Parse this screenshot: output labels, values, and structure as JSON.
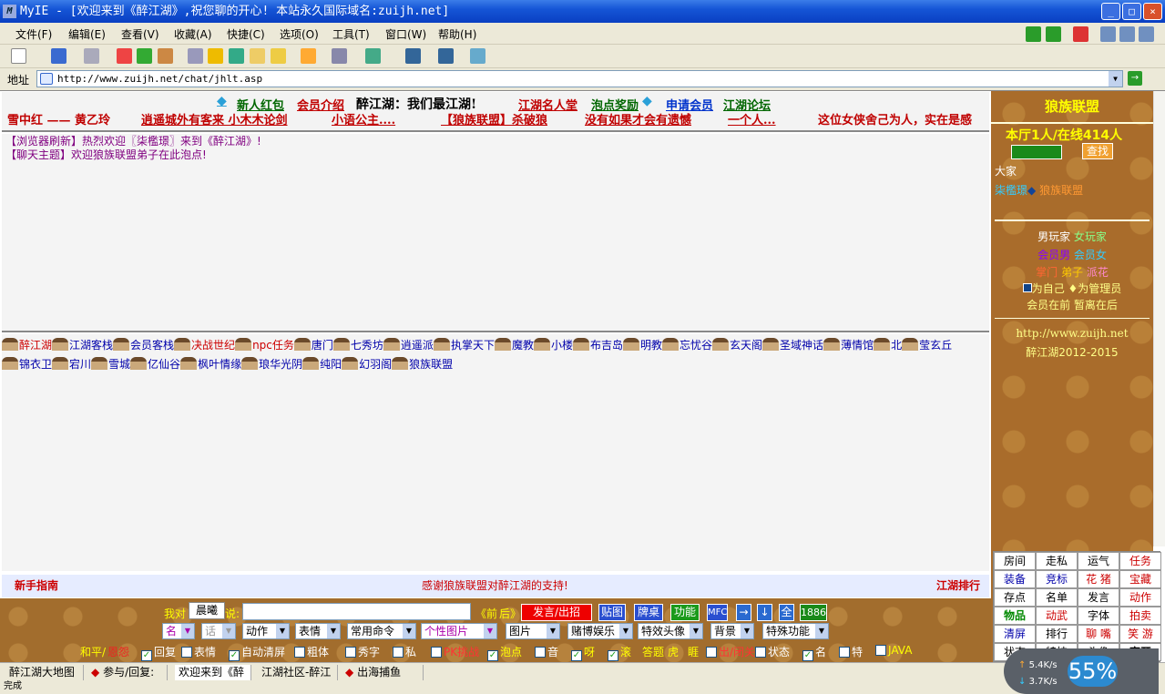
{
  "window": {
    "title": "MyIE - [欢迎来到《醉江湖》,祝您聊的开心! 本站永久国际域名:zuijh.net]",
    "logo": "M",
    "btn_minimize": "_",
    "btn_maximize": "□",
    "btn_close": "×"
  },
  "menu": [
    "文件(F)",
    "编辑(E)",
    "查看(V)",
    "收藏(A)",
    "快捷(C)",
    "选项(O)",
    "工具(T)",
    "窗口(W)",
    "帮助(H)"
  ],
  "address": {
    "label": "地址",
    "url": "http://www.zuijh.net/chat/jhlt.asp",
    "dropdown": "▼",
    "go": "→"
  },
  "topnav": {
    "row1": [
      "新人红包",
      "会员介绍",
      "醉江湖：我们最江湖!",
      "江湖名人堂",
      "泡点奖励",
      "申请会员",
      "江湖论坛"
    ],
    "row2": [
      "雪中红 —— 黄乙玲",
      "逍遥城外有客来 小木木论剑",
      "小语公主....",
      "【狼族联盟】杀破狼",
      "没有如果才会有遗憾",
      "一个人...",
      "这位女侠舍己为人，实在是感"
    ]
  },
  "chat_lines": [
    "【浏览器刷新】热烈欢迎〖柒檻璟〗来到《醉江湖》!",
    "【聊天主题】欢迎狼族联盟弟子在此泡点!"
  ],
  "rooms": [
    "醉江湖",
    "江湖客栈",
    "会员客栈",
    "决战世纪",
    "npc任务",
    "唐门",
    "七秀坊",
    "逍遥派",
    "执掌天下",
    "魔教",
    "小楼",
    "布吉岛",
    "明教",
    "忘忧谷",
    "玄天阁",
    "圣域神话",
    "薄情馆",
    "北",
    "莹玄丘",
    "锦衣卫",
    "宕川",
    "雪城",
    "亿仙谷",
    "枫叶情缘",
    "琅华光阴",
    "纯阳",
    "幻羽阁",
    "狼族联盟"
  ],
  "guide": {
    "left": "新手指南",
    "center": "感谢狼族联盟对醉江湖的支持!",
    "right": "江湖排行"
  },
  "input": {
    "i_say": "我对",
    "target": "晨曦",
    "say": "说:",
    "front": "《前",
    "back": "后》",
    "send": "发言/出招",
    "post": "贴图",
    "desk": "牌桌",
    "func": "功能",
    "mfc": "MFC",
    "right": "→",
    "down": "↓",
    "all": "全",
    "num": "1886",
    "selects": [
      "名",
      "话",
      "动作",
      "表情",
      "常用命令",
      "个性图片",
      "图片",
      "赌博娱乐",
      "特效头像",
      "背景",
      "特殊功能"
    ],
    "peace": "和平/",
    "angry": "恩怨",
    "checks": [
      {
        "l": "回复",
        "c": true
      },
      {
        "l": "表情",
        "c": false
      },
      {
        "l": "自动清屏",
        "c": true
      },
      {
        "l": "粗体",
        "c": false
      },
      {
        "l": "秀字",
        "c": false
      },
      {
        "l": "私",
        "c": false
      },
      {
        "l": "PK挑战",
        "c": false
      },
      {
        "l": "泡点",
        "c": true
      },
      {
        "l": "音",
        "c": false
      },
      {
        "l": "呀",
        "c": true
      },
      {
        "l": "滚",
        "c": true
      },
      {
        "l": "答题",
        "c": false
      },
      {
        "l": "虎",
        "c": false
      },
      {
        "l": "睚",
        "c": false
      },
      {
        "l": "出/闭关",
        "c": false
      },
      {
        "l": "状态",
        "c": false
      },
      {
        "l": "名",
        "c": true
      },
      {
        "l": "特",
        "c": false
      },
      {
        "l": "JAVA",
        "c": false
      }
    ]
  },
  "panel": {
    "title": "狼族联盟",
    "online": "本厅1人/在线414人",
    "search": "查找",
    "all": "大家",
    "user": "柒檻璟",
    "user_group": "狼族联盟",
    "legend1a": "男玩家",
    "legend1b": "女玩家",
    "legend2a": "会员男",
    "legend2b": "会员女",
    "legend3a": "掌门",
    "legend3b": "弟子",
    "legend3c": "派花",
    "legend4": "为自己 ♦为管理员",
    "legend5": "会员在前 暂离在后",
    "site": "http://www.zuijh.net",
    "years": "醉江湖2012-2015"
  },
  "grid": [
    "房间",
    "走私",
    "运气",
    "任务",
    "装备",
    "竞标",
    "花 猪",
    "宝藏",
    "存点",
    "名单",
    "发言",
    "动作",
    "物品",
    "动武",
    "字体",
    "拍卖",
    "清屏",
    "排行",
    "聊 嘴",
    "笑 游",
    "状态",
    "特技",
    "头像",
    "离开"
  ],
  "tasks": [
    "醉江湖大地图",
    "参与/回复:",
    "欢迎来到《醉",
    "江湖社区-醉江",
    "出海捕鱼"
  ],
  "status": {
    "left": "完成",
    "up": "5.4K/s",
    "down": "3.7K/s",
    "pct": "55%"
  }
}
